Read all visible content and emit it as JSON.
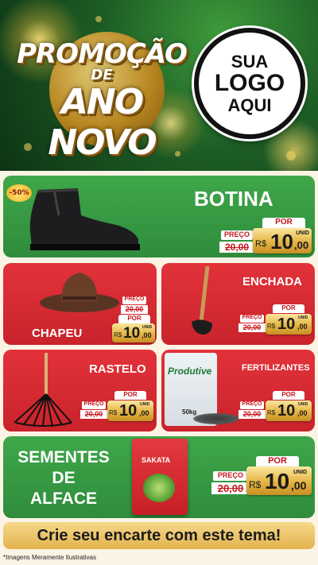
{
  "header": {
    "title_line1": "PROMOÇÃO",
    "title_line2": "DE",
    "title_line3": "ANO NOVO",
    "logo_line1": "SUA",
    "logo_line2": "LOGO",
    "logo_line3": "AQUI"
  },
  "discount_badge": "-50%",
  "products": [
    {
      "name": "BOTINA",
      "preco_label": "PREÇO",
      "old_price": "20,00",
      "por_label": "POR",
      "currency": "R$",
      "price_int": "10",
      "price_cents": ",00",
      "unit": "UNID"
    },
    {
      "name": "CHAPEU",
      "preco_label": "PREÇO",
      "old_price": "20,00",
      "por_label": "POR",
      "currency": "R$",
      "price_int": "10",
      "price_cents": ",00",
      "unit": "UNID"
    },
    {
      "name": "ENCHADA",
      "preco_label": "PREÇO",
      "old_price": "20,00",
      "por_label": "POR",
      "currency": "R$",
      "price_int": "10",
      "price_cents": ",00",
      "unit": "UNID"
    },
    {
      "name": "RASTELO",
      "preco_label": "PREÇO",
      "old_price": "20,00",
      "por_label": "POR",
      "currency": "R$",
      "price_int": "10",
      "price_cents": ",00",
      "unit": "UNID"
    },
    {
      "name": "FERTILIZANTES",
      "preco_label": "PREÇO",
      "old_price": "20,00",
      "por_label": "POR",
      "currency": "R$",
      "price_int": "10",
      "price_cents": ",00",
      "unit": "UNID"
    },
    {
      "name_line1": "SEMENTES",
      "name_line2": "DE",
      "name_line3": "ALFACE",
      "preco_label": "PREÇO",
      "old_price": "20,00",
      "por_label": "POR",
      "currency": "R$",
      "price_int": "10",
      "price_cents": ",00",
      "unit": "UNID"
    }
  ],
  "fertilizer_bag": {
    "brand": "Produtive",
    "weight": "50kg"
  },
  "seed_packet": {
    "brand": "SAKATA"
  },
  "banner": "Crie seu encarte com este tema!",
  "footnote": "*Imagens Meramente Ilustrativas"
}
